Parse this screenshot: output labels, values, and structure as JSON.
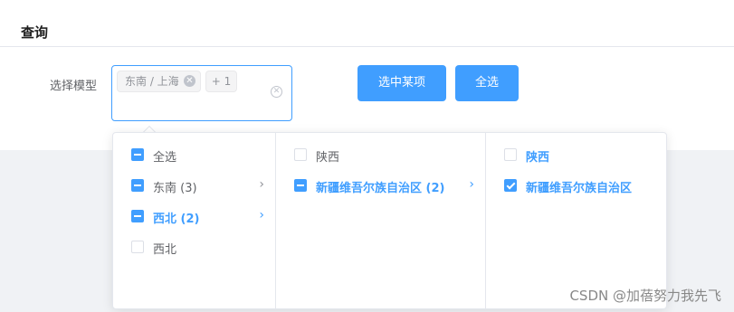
{
  "page": {
    "title": "查询"
  },
  "form": {
    "label": "选择模型"
  },
  "cascader": {
    "tags": [
      "东南 / 上海",
      "+ 1"
    ]
  },
  "buttons": {
    "select_one": "选中某项",
    "select_all": "全选"
  },
  "dropdown": {
    "panel1": [
      {
        "label": "全选",
        "state": "indeterminate",
        "has_children": false
      },
      {
        "label": "东南 (3)",
        "state": "indeterminate",
        "has_children": true
      },
      {
        "label": "西北 (2)",
        "state": "indeterminate",
        "has_children": true,
        "active": true
      },
      {
        "label": "西北",
        "state": "unchecked",
        "has_children": false
      }
    ],
    "panel2": [
      {
        "label": "陕西",
        "state": "unchecked",
        "has_children": false
      },
      {
        "label": "新疆维吾尔族自治区 (2)",
        "state": "indeterminate",
        "has_children": true,
        "active": true
      }
    ],
    "panel3": [
      {
        "label": "陕西",
        "state": "unchecked",
        "has_children": false,
        "active": true
      },
      {
        "label": "新疆维吾尔族自治区",
        "state": "checked",
        "has_children": false,
        "active": true
      }
    ]
  },
  "watermark": "CSDN @加蓓努力我先飞",
  "colors": {
    "primary": "#409eff",
    "border": "#dcdfe6",
    "bg_gray": "#f0f2f5"
  }
}
